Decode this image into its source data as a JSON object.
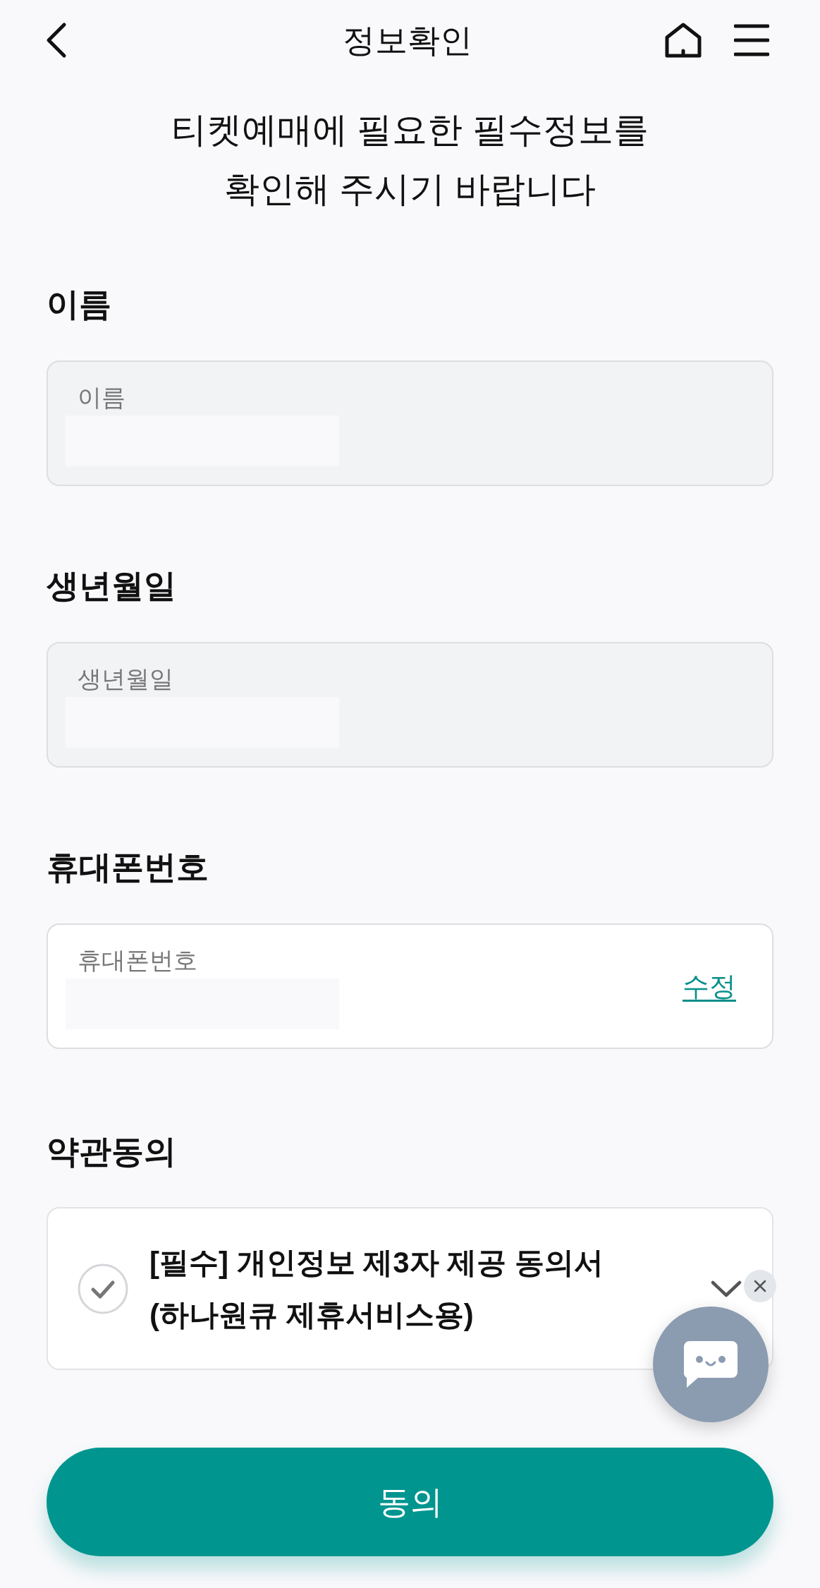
{
  "header": {
    "title": "정보확인"
  },
  "intro": "티켓예매에 필요한 필수정보를 확인해 주시기 바랍니다",
  "fields": [
    {
      "section_label": "이름",
      "label": "이름",
      "disabled": true
    },
    {
      "section_label": "생년월일",
      "label": "생년월일",
      "disabled": true
    },
    {
      "section_label": "휴대폰번호",
      "label": "휴대폰번호",
      "disabled": false,
      "action": "수정"
    }
  ],
  "terms": {
    "section_label": "약관동의",
    "items": [
      {
        "text": "[필수] 개인정보 제3자 제공 동의서 (하나원큐 제휴서비스용)",
        "checked": false,
        "expanded": false
      }
    ]
  },
  "submit_button": {
    "label": "동의"
  }
}
